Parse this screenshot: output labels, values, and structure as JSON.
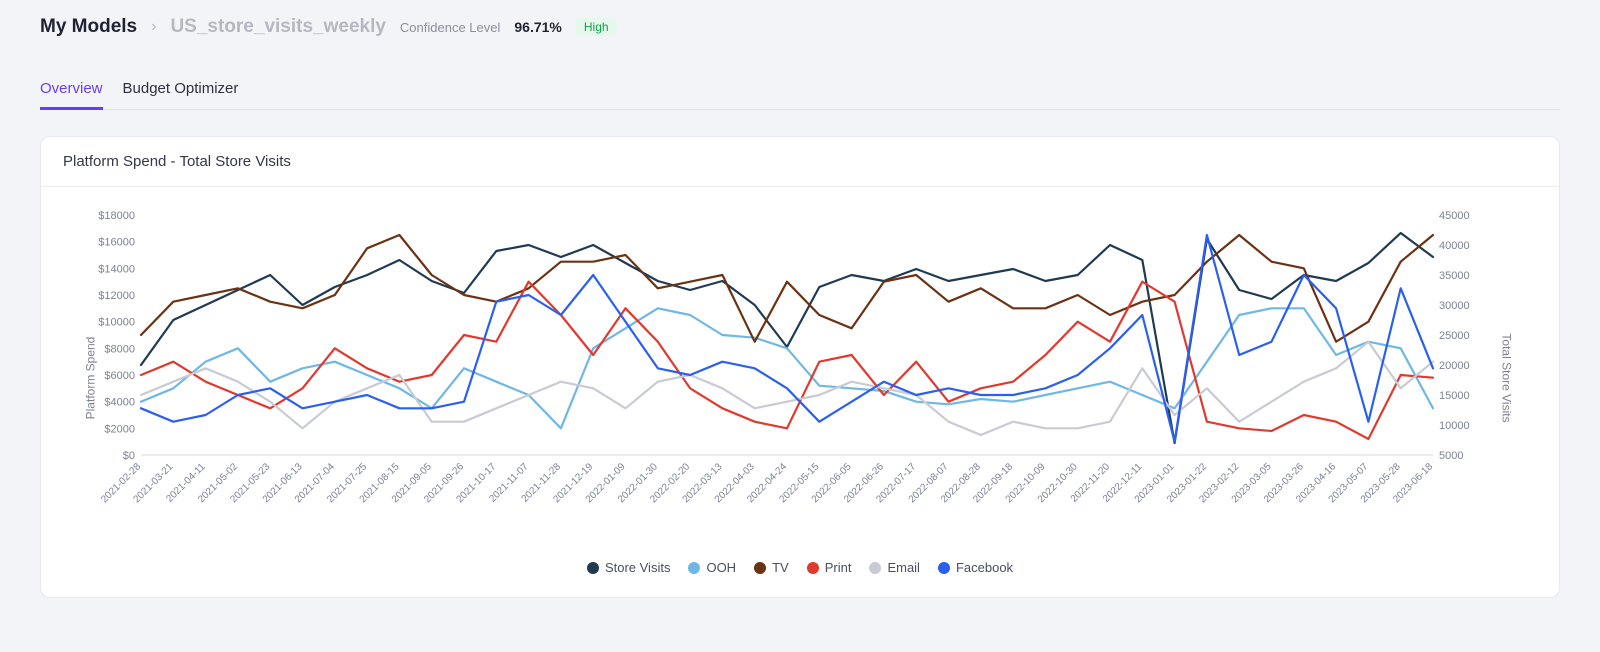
{
  "breadcrumb": {
    "root": "My Models",
    "model": "US_store_visits_weekly",
    "conf_label": "Confidence Level",
    "conf_value": "96.71%",
    "badge": "High"
  },
  "tabs": {
    "overview": "Overview",
    "optimizer": "Budget Optimizer"
  },
  "card": {
    "title": "Platform Spend - Total Store Visits"
  },
  "chart_data": {
    "type": "line",
    "title": "Platform Spend - Total Store Visits",
    "xlabel": "",
    "y_left_label": "Platform Spend",
    "y_right_label": "Total Store Visits",
    "y_left_lim": [
      0,
      18000
    ],
    "y_right_lim": [
      5000,
      45000
    ],
    "y_left_ticks": [
      "$0",
      "$2000",
      "$4000",
      "$6000",
      "$8000",
      "$10000",
      "$12000",
      "$14000",
      "$16000",
      "$18000"
    ],
    "y_right_ticks": [
      "5000",
      "10000",
      "15000",
      "20000",
      "25000",
      "30000",
      "35000",
      "40000",
      "45000"
    ],
    "x_ticks": [
      "2021-02-28",
      "2021-03-21",
      "2021-04-11",
      "2021-05-02",
      "2021-05-23",
      "2021-06-13",
      "2021-07-04",
      "2021-07-25",
      "2021-08-15",
      "2021-09-05",
      "2021-09-26",
      "2021-10-17",
      "2021-11-07",
      "2021-11-28",
      "2021-12-19",
      "2022-01-09",
      "2022-01-30",
      "2022-02-20",
      "2022-03-13",
      "2022-04-03",
      "2022-04-24",
      "2022-05-15",
      "2022-06-05",
      "2022-06-26",
      "2022-07-17",
      "2022-08-07",
      "2022-08-28",
      "2022-09-18",
      "2022-10-09",
      "2022-10-30",
      "2022-11-20",
      "2022-12-11",
      "2023-01-01",
      "2023-01-22",
      "2023-02-12",
      "2023-03-05",
      "2023-03-26",
      "2023-04-16",
      "2023-05-07",
      "2023-05-28",
      "2023-06-18"
    ],
    "categories": [
      "2021-02-28",
      "2021-03-21",
      "2021-04-11",
      "2021-05-02",
      "2021-05-23",
      "2021-06-13",
      "2021-07-04",
      "2021-07-25",
      "2021-08-15",
      "2021-09-05",
      "2021-09-26",
      "2021-10-17",
      "2021-11-07",
      "2021-11-28",
      "2021-12-19",
      "2022-01-09",
      "2022-01-30",
      "2022-02-20",
      "2022-03-13",
      "2022-04-03",
      "2022-04-24",
      "2022-05-15",
      "2022-06-05",
      "2022-06-26",
      "2022-07-17",
      "2022-08-07",
      "2022-08-28",
      "2022-09-18",
      "2022-10-09",
      "2022-10-30",
      "2022-11-20",
      "2022-12-11",
      "2023-01-01",
      "2023-01-22",
      "2023-02-12",
      "2023-03-05",
      "2023-03-26",
      "2023-04-16",
      "2023-05-07",
      "2023-05-28",
      "2023-06-18"
    ],
    "legend": [
      "Store Visits",
      "OOH",
      "TV",
      "Print",
      "Email",
      "Facebook"
    ],
    "colors": {
      "Store Visits": "#1f3a52",
      "OOH": "#6fb8e5",
      "TV": "#6a3314",
      "Print": "#e03a2f",
      "Email": "#c9cbd4",
      "Facebook": "#2a5ff0"
    },
    "series": [
      {
        "name": "Store Visits",
        "axis": "right",
        "values": [
          20000,
          27500,
          30000,
          32500,
          35000,
          30000,
          33000,
          35000,
          37500,
          34000,
          32000,
          39000,
          40000,
          38000,
          40000,
          37000,
          34000,
          32500,
          34000,
          30000,
          23000,
          33000,
          35000,
          34000,
          36000,
          34000,
          35000,
          36000,
          34000,
          35000,
          40000,
          37500,
          7000,
          41000,
          32500,
          31000,
          35000,
          34000,
          37000,
          42000,
          38000
        ]
      },
      {
        "name": "OOH",
        "axis": "left",
        "values": [
          4000,
          5000,
          7000,
          8000,
          5500,
          6500,
          7000,
          6000,
          5000,
          3500,
          6500,
          5500,
          4500,
          2000,
          8000,
          9500,
          11000,
          10500,
          9000,
          8800,
          8000,
          5200,
          5000,
          4800,
          4000,
          3800,
          4200,
          4000,
          4500,
          5000,
          5500,
          4500,
          3500,
          7000,
          10500,
          11000,
          11000,
          7500,
          8500,
          8000,
          3500
        ]
      },
      {
        "name": "TV",
        "axis": "left",
        "values": [
          9000,
          11500,
          12000,
          12500,
          11500,
          11000,
          12000,
          15500,
          16500,
          13500,
          12000,
          11500,
          12500,
          14500,
          14500,
          15000,
          12500,
          13000,
          13500,
          8500,
          13000,
          10500,
          9500,
          13000,
          13500,
          11500,
          12500,
          11000,
          11000,
          12000,
          10500,
          11500,
          12000,
          14500,
          16500,
          14500,
          14000,
          8500,
          10000,
          14500,
          16500
        ]
      },
      {
        "name": "Print",
        "axis": "left",
        "values": [
          6000,
          7000,
          5500,
          4500,
          3500,
          5000,
          8000,
          6500,
          5500,
          6000,
          9000,
          8500,
          13000,
          10500,
          7500,
          11000,
          8500,
          5000,
          3500,
          2500,
          2000,
          7000,
          7500,
          4500,
          7000,
          4000,
          5000,
          5500,
          7500,
          10000,
          8500,
          13000,
          11500,
          2500,
          2000,
          1800,
          3000,
          2500,
          1200,
          6000,
          5800
        ]
      },
      {
        "name": "Email",
        "axis": "left",
        "values": [
          4500,
          5500,
          6500,
          5500,
          4000,
          2000,
          4000,
          5000,
          6000,
          2500,
          2500,
          3500,
          4500,
          5500,
          5000,
          3500,
          5500,
          6000,
          5000,
          3500,
          4000,
          4500,
          5500,
          5000,
          4500,
          2500,
          1500,
          2500,
          2000,
          2000,
          2500,
          6500,
          3000,
          5000,
          2500,
          4000,
          5500,
          6500,
          8500,
          5000,
          7000
        ]
      },
      {
        "name": "Facebook",
        "axis": "left",
        "values": [
          3500,
          2500,
          3000,
          4500,
          5000,
          3500,
          4000,
          4500,
          3500,
          3500,
          4000,
          11500,
          12000,
          10500,
          13500,
          10000,
          6500,
          6000,
          7000,
          6500,
          5000,
          2500,
          4000,
          5500,
          4500,
          5000,
          4500,
          4500,
          5000,
          6000,
          8000,
          10500,
          1000,
          16500,
          7500,
          8500,
          13500,
          11000,
          2500,
          12500,
          6500
        ]
      }
    ]
  }
}
